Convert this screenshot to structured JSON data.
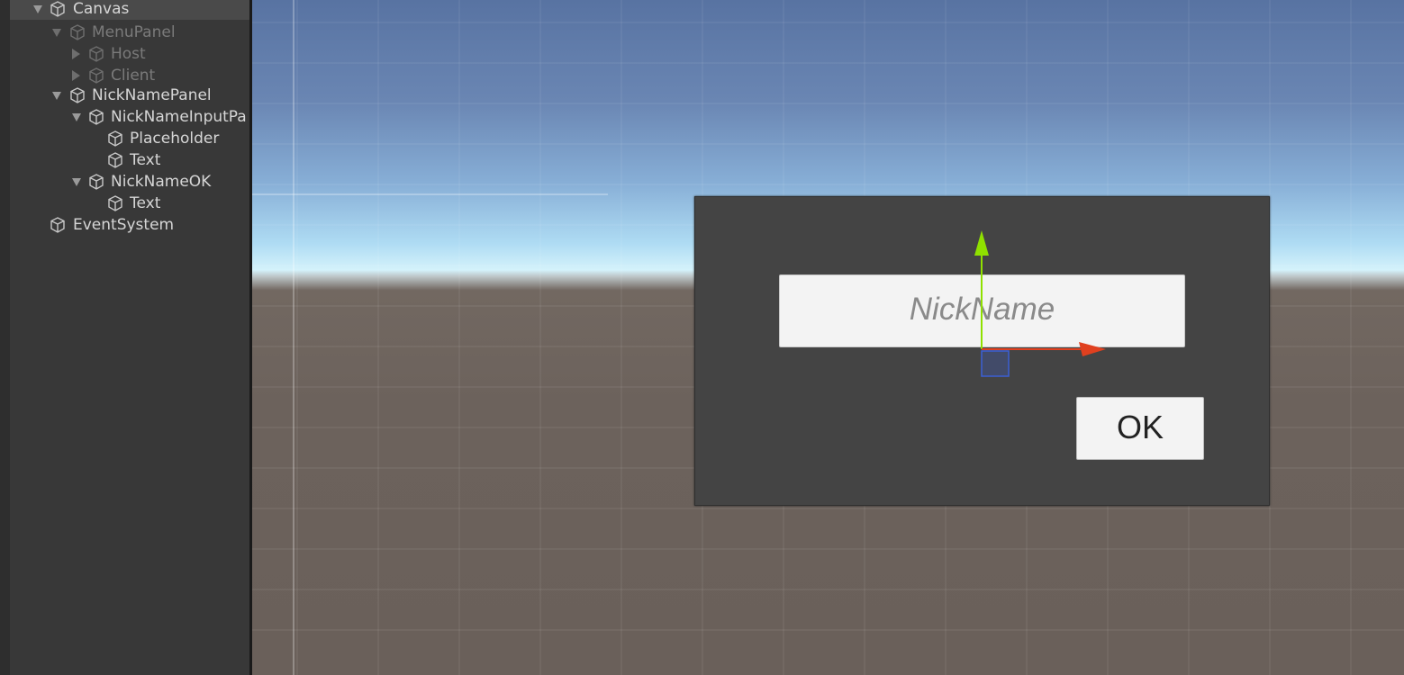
{
  "hierarchy": {
    "items": [
      {
        "label": "Canvas",
        "expanded": true,
        "active": true
      },
      {
        "label": "MenuPanel",
        "expanded": true,
        "active": false
      },
      {
        "label": "Host",
        "expanded": false,
        "active": false
      },
      {
        "label": "Client",
        "expanded": false,
        "active": false
      },
      {
        "label": "NickNamePanel",
        "expanded": true,
        "active": true
      },
      {
        "label": "NickNameInputPa",
        "expanded": true,
        "active": true
      },
      {
        "label": "Placeholder",
        "active": true
      },
      {
        "label": "Text",
        "active": true
      },
      {
        "label": "NickNameOK",
        "expanded": true,
        "active": true
      },
      {
        "label": "Text",
        "active": true
      },
      {
        "label": "EventSystem",
        "active": true
      }
    ]
  },
  "scene": {
    "input": {
      "placeholder": "NickName"
    },
    "ok_button": {
      "label": "OK"
    },
    "gizmo": {
      "x_axis_color": "#e0401f",
      "y_axis_color": "#8fe000",
      "rect_color": "#3b5fd6"
    }
  }
}
